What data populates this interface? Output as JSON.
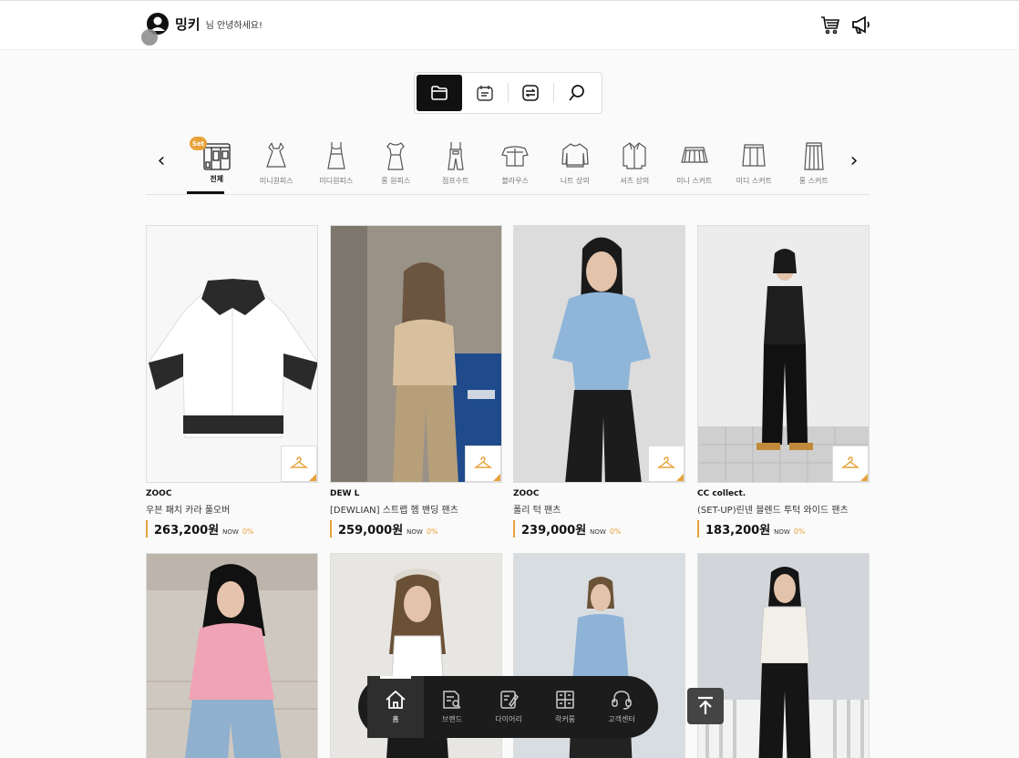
{
  "header": {
    "user_name": "밍키",
    "greeting": "님 안녕하세요!",
    "icons": [
      "avatar-icon",
      "cart-icon",
      "megaphone-icon"
    ]
  },
  "tabs": [
    {
      "icon": "folder-icon",
      "active": true
    },
    {
      "icon": "calendar-icon",
      "active": false
    },
    {
      "icon": "filter-icon",
      "active": false
    },
    {
      "icon": "search-icon",
      "active": false
    }
  ],
  "categories": {
    "prev": "‹",
    "next": "›",
    "set_badge": "Set",
    "items": [
      "전체",
      "미니원피스",
      "미디원피스",
      "롱 원피스",
      "점프수트",
      "블라우스",
      "니트 상의",
      "셔츠 상의",
      "미니 스커트",
      "미디 스커트",
      "롱 스커트"
    ]
  },
  "products": [
    {
      "brand": "ZOOC",
      "name": "우븐 패치 카라 풀오버",
      "price": "263,200원",
      "now": "NOW",
      "discount": "0%"
    },
    {
      "brand": "DEW L",
      "name": "[DEWLIAN] 스트랩 헴 밴딩 팬츠",
      "price": "259,000원",
      "now": "NOW",
      "discount": "0%"
    },
    {
      "brand": "ZOOC",
      "name": "폴리 턱 팬츠",
      "price": "239,000원",
      "now": "NOW",
      "discount": "0%"
    },
    {
      "brand": "CC collect.",
      "name": "(SET-UP)린넨 블렌드 투턱 와이드 팬츠",
      "price": "183,200원",
      "now": "NOW",
      "discount": "0%"
    }
  ],
  "bottom_nav": [
    {
      "label": "홈",
      "icon": "home-icon",
      "active": true
    },
    {
      "label": "브랜드",
      "icon": "brand-icon",
      "active": false
    },
    {
      "label": "다이어리",
      "icon": "diary-icon",
      "active": false
    },
    {
      "label": "락커룸",
      "icon": "locker-icon",
      "active": false
    },
    {
      "label": "고객센터",
      "icon": "headset-icon",
      "active": false
    }
  ],
  "colors": {
    "accent": "#e8a23a",
    "dark": "#1c1c1c"
  }
}
